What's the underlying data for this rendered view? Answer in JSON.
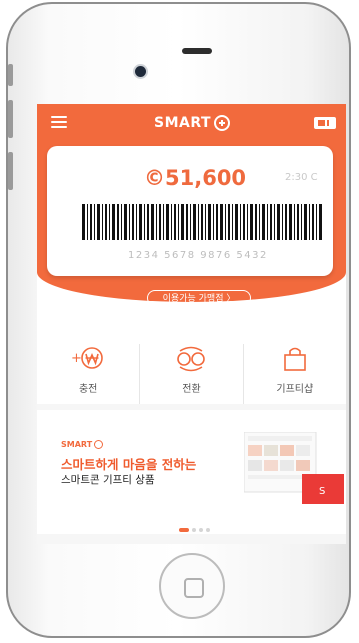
{
  "app": {
    "logo_text": "SMART",
    "accent_color": "#f26a3d"
  },
  "card": {
    "balance": "©51,600",
    "time": "2:30 C",
    "code_number": "1234  5678  9876  5432"
  },
  "stores_button": "이용가능 가맹점 〉",
  "actions": [
    {
      "label": "충전",
      "icon": "won-charge-icon"
    },
    {
      "label": "전환",
      "icon": "convert-icon"
    },
    {
      "label": "기프티샵",
      "icon": "shopping-bag-icon"
    }
  ],
  "promo": {
    "brand": "SMART",
    "headline": "스마트하게 마음을 전하는",
    "subline": "스마트콘 기프티 상품"
  }
}
